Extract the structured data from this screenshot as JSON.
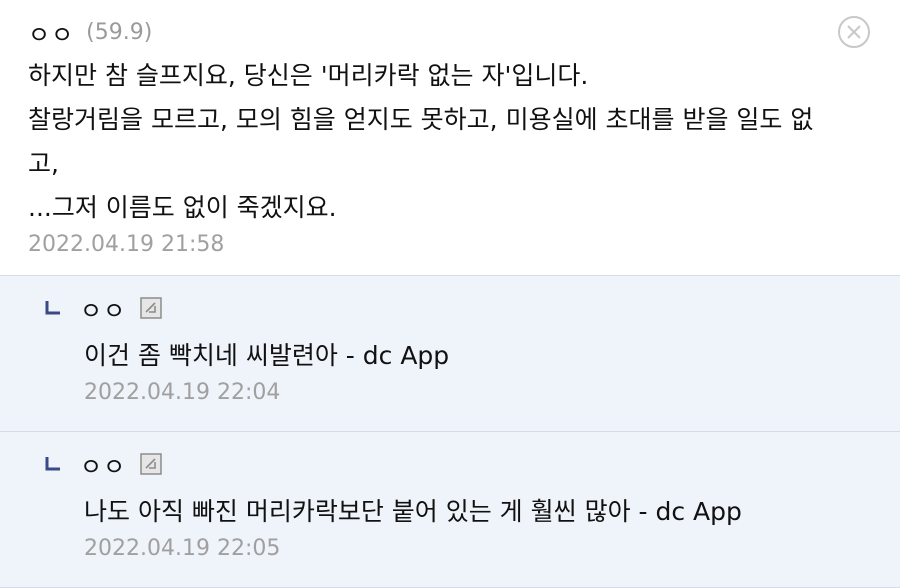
{
  "main_comment": {
    "nickname": "ㅇㅇ",
    "ip": "(59.9)",
    "lines": [
      "하지만 참 슬프지요, 당신은 '머리카락 없는 자'입니다.",
      "찰랑거림을 모르고, 모의 힘을 얻지도 못하고, 미용실에 초대를 받을 일도 없",
      "고,",
      "...그저 이름도 없이 죽겠지요."
    ],
    "date": "2022.04.19 21:58"
  },
  "replies": [
    {
      "nickname": "ㅇㅇ",
      "text": "이건 좀 빡치네 씨발련아 - dc App",
      "date": "2022.04.19 22:04"
    },
    {
      "nickname": "ㅇㅇ",
      "text": "나도 아직 빠진 머리카락보단 붙어 있는 게 훨씬 많아 - dc App",
      "date": "2022.04.19 22:05"
    }
  ],
  "icons": {
    "close": "close-circle-icon",
    "reply_arrow": "reply-corner-icon",
    "mobile": "mobile-app-icon"
  }
}
